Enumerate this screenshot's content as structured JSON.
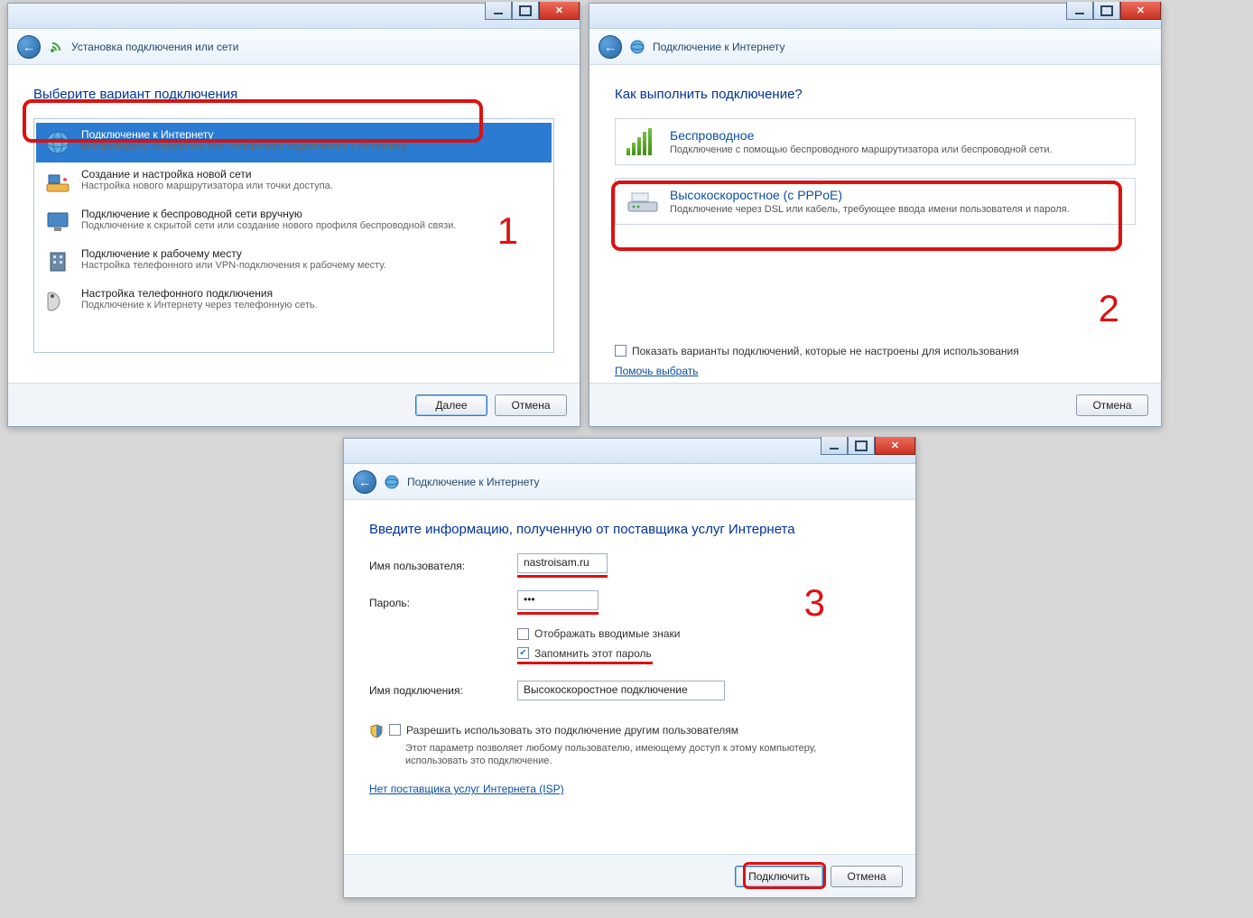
{
  "win1": {
    "header": "Установка подключения или сети",
    "title": "Выберите вариант подключения",
    "options": [
      {
        "t": "Подключение к Интернету",
        "sub": "Беспроводное, скоростное или телефонное подключение к Интернету."
      },
      {
        "t": "Создание и настройка новой сети",
        "sub": "Настройка нового маршрутизатора или точки доступа."
      },
      {
        "t": "Подключение к беспроводной сети вручную",
        "sub": "Подключение к скрытой сети или создание нового профиля беспроводной связи."
      },
      {
        "t": "Подключение к рабочему месту",
        "sub": "Настройка телефонного или VPN-подключения к рабочему месту."
      },
      {
        "t": "Настройка телефонного подключения",
        "sub": "Подключение к Интернету через телефонную сеть."
      }
    ],
    "next": "Далее",
    "cancel": "Отмена",
    "step": "1"
  },
  "win2": {
    "header": "Подключение к Интернету",
    "title": "Как выполнить подключение?",
    "opt_wireless": {
      "t": "Беспроводное",
      "sub": "Подключение с помощью беспроводного маршрутизатора или беспроводной сети."
    },
    "opt_pppoe": {
      "t": "Высокоскоростное (с PPPoE)",
      "sub": "Подключение через DSL или кабель, требующее ввода имени пользователя и пароля."
    },
    "show_label": "Показать варианты подключений, которые не настроены для использования",
    "help_link": "Помочь выбрать",
    "cancel": "Отмена",
    "step": "2"
  },
  "win3": {
    "header": "Подключение к Интернету",
    "title": "Введите информацию, полученную от поставщика услуг Интернета",
    "user_lbl": "Имя пользователя:",
    "user_val": "nastroisam.ru",
    "pass_lbl": "Пароль:",
    "pass_val": "•••",
    "show_chars": "Отображать вводимые знаки",
    "remember": "Запомнить этот пароль",
    "conn_lbl": "Имя подключения:",
    "conn_val": "Высокоскоростное подключение",
    "share_lbl": "Разрешить использовать это подключение другим пользователям",
    "share_note": "Этот параметр позволяет любому пользователю, имеющему доступ к этому компьютеру, использовать это подключение.",
    "isp_link": "Нет поставщика услуг Интернета (ISP)",
    "connect": "Подключить",
    "cancel": "Отмена",
    "step": "3"
  }
}
